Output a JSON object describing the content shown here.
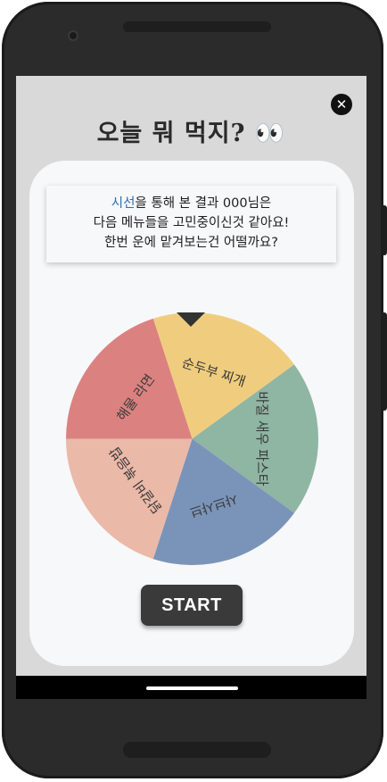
{
  "title": {
    "text": "오늘 뭐 먹지? 👀"
  },
  "message": {
    "highlight": "시선",
    "line1_rest": "을 통해 본 결과 000님은",
    "line2": "다음 메뉴들을 고민중이신것 같아요!",
    "line3": "한번 운에 맡겨보는건 어떨까요?"
  },
  "wheel": {
    "segments": [
      {
        "label": "순두부 찌개",
        "color": "#f0cd7e"
      },
      {
        "label": "바질 새우 파스타",
        "color": "#8fb5a3"
      },
      {
        "label": "샤브샤브",
        "color": "#7a94b9"
      },
      {
        "label": "닭갈비 볶음밥",
        "color": "#ebb9a8"
      },
      {
        "label": "해물 라면",
        "color": "#db8280"
      }
    ]
  },
  "start_button": {
    "label": "START"
  },
  "icons": {
    "close": "close-icon",
    "pointer": "pointer-icon"
  }
}
